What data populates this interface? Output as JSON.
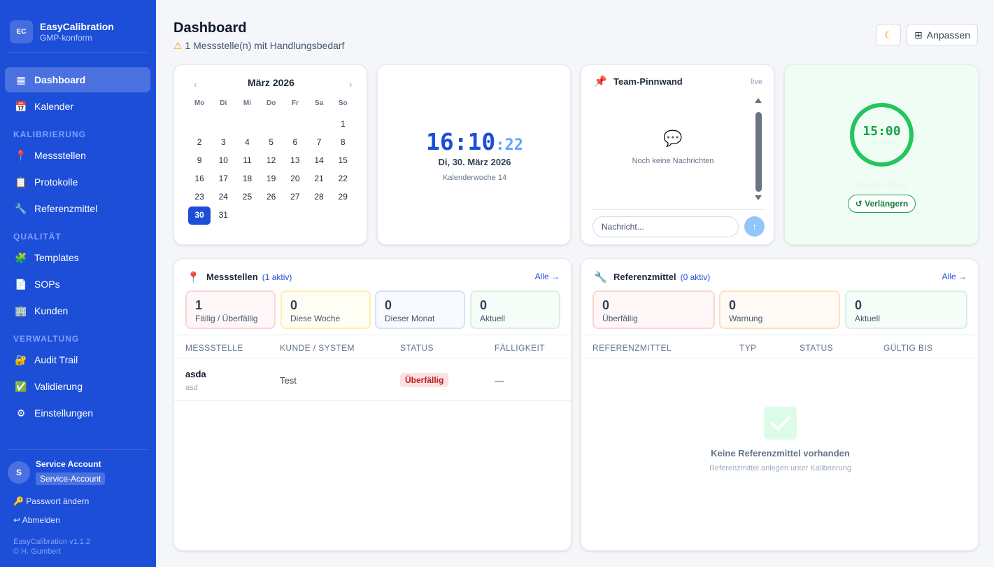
{
  "sidebar": {
    "brand": {
      "logo": "EC",
      "name": "EasyCalibration",
      "subtitle": "GMP-konform"
    },
    "nav": [
      {
        "label": "Dashboard",
        "icon": "dashboard-icon"
      },
      {
        "label": "Kalender",
        "icon": "calendar-icon"
      }
    ],
    "sections": [
      {
        "title": "KALIBRIERUNG",
        "items": [
          {
            "label": "Messstellen",
            "icon": "pin-icon"
          },
          {
            "label": "Protokolle",
            "icon": "clipboard-icon"
          },
          {
            "label": "Referenzmittel",
            "icon": "wrench-icon"
          }
        ]
      },
      {
        "title": "QUALITÄT",
        "items": [
          {
            "label": "Templates",
            "icon": "puzzle-icon"
          },
          {
            "label": "SOPs",
            "icon": "document-icon"
          },
          {
            "label": "Kunden",
            "icon": "building-icon"
          }
        ]
      },
      {
        "title": "VERWALTUNG",
        "items": [
          {
            "label": "Audit Trail",
            "icon": "lock-icon"
          },
          {
            "label": "Validierung",
            "icon": "check-icon"
          },
          {
            "label": "Einstellungen",
            "icon": "gear-icon"
          }
        ]
      }
    ],
    "user": {
      "initial": "S",
      "name": "Service Account",
      "role": "Service-Account"
    },
    "links": {
      "password": "🔑 Passwort ändern",
      "logout": "↩ Abmelden"
    },
    "footer": {
      "version": "EasyCalibration v1.1.2",
      "copyright": "© H. Gumbert"
    }
  },
  "header": {
    "title": "Dashboard",
    "alert": "1 Messstelle(n) mit Handlungsbedarf",
    "customize_label": "Anpassen"
  },
  "calendar": {
    "month": "März 2026",
    "weekdays": [
      "Mo",
      "Di",
      "Mi",
      "Do",
      "Fr",
      "Sa",
      "So"
    ],
    "leading_blanks": 6,
    "days_in_month": 31,
    "today": 30
  },
  "clock": {
    "hm": "16:10",
    "sec": ":22",
    "date": "Di, 30. März 2026",
    "week": "Kalenderwoche 14"
  },
  "pinwand": {
    "title": "Team-Pinnwand",
    "live": "live",
    "empty": "Noch keine Nachrichten",
    "placeholder": "Nachricht...",
    "send": "↑"
  },
  "session": {
    "time": "15:00",
    "ring_sub": "verbleibend",
    "label": "Session-Timer",
    "extend": "↺ Verlängern"
  },
  "messstellen": {
    "title": "Messstellen",
    "count": "(1 aktiv)",
    "all": "Alle →",
    "stats": [
      {
        "value": "1",
        "label": "Fällig / Überfällig"
      },
      {
        "value": "0",
        "label": "Diese Woche"
      },
      {
        "value": "0",
        "label": "Dieser Monat"
      },
      {
        "value": "0",
        "label": "Aktuell"
      }
    ],
    "columns": [
      "MESSSTELLE",
      "KUNDE / SYSTEM",
      "STATUS",
      "FÄLLIGKEIT"
    ],
    "rows": [
      {
        "name": "asda",
        "sub": "asd",
        "customer": "Test",
        "status": "Überfällig",
        "due": "—"
      }
    ]
  },
  "referenzmittel": {
    "title": "Referenzmittel",
    "count": "(0 aktiv)",
    "all": "Alle →",
    "stats": [
      {
        "value": "0",
        "label": "Überfällig"
      },
      {
        "value": "0",
        "label": "Warnung"
      },
      {
        "value": "0",
        "label": "Aktuell"
      }
    ],
    "columns": [
      "REFERENZMITTEL",
      "TYP",
      "STATUS",
      "GÜLTIG BIS"
    ],
    "empty_title": "Keine Referenzmittel vorhanden",
    "empty_sub": "Referenzmittel anlegen unter Kalibrierung"
  },
  "colors": {
    "primary": "#1d4ed8",
    "danger": "#dc2626",
    "success": "#16a34a",
    "warning": "#f59e0b"
  }
}
